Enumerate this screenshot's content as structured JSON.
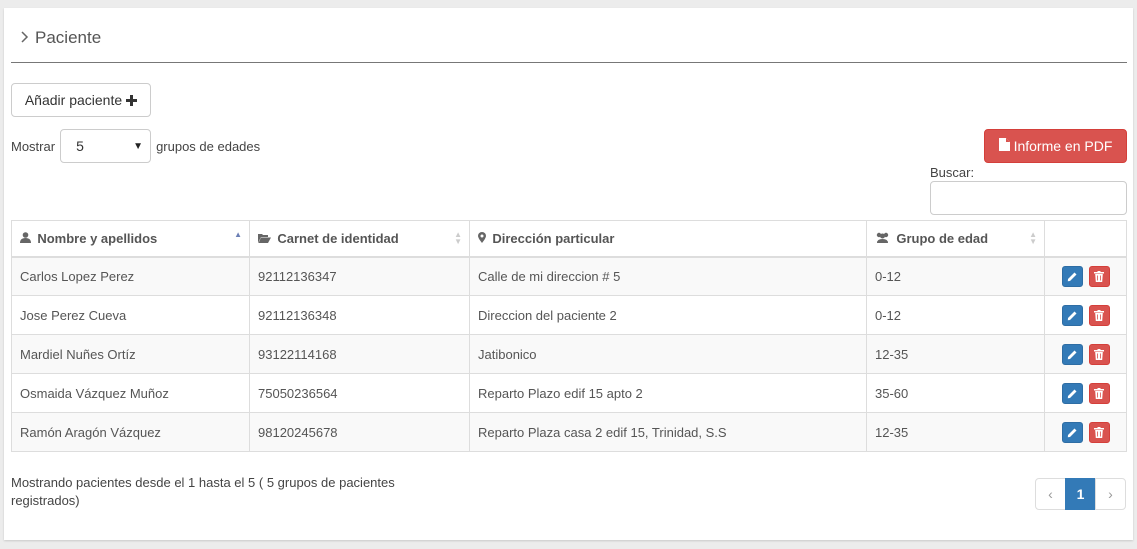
{
  "header": {
    "title": "Paciente",
    "chevron_icon": "chevron-right-icon"
  },
  "toolbar": {
    "add_label": "Añadir paciente",
    "add_icon": "plus-icon"
  },
  "length": {
    "prefix": "Mostrar",
    "selected": "5",
    "suffix": "grupos de edades"
  },
  "pdf": {
    "label": "Informe en PDF",
    "icon": "file-icon",
    "color": "#d9534f"
  },
  "search": {
    "label": "Buscar:",
    "value": "",
    "placeholder": ""
  },
  "table": {
    "headers": [
      {
        "label": "Nombre y apellidos",
        "icon": "user-icon"
      },
      {
        "label": "Carnet de identidad",
        "icon": "folder-open-icon"
      },
      {
        "label": "Dirección particular",
        "icon": "map-marker-icon"
      },
      {
        "label": "Grupo de edad",
        "icon": "users-icon"
      },
      {
        "label": ""
      }
    ],
    "rows": [
      [
        "Carlos Lopez Perez",
        "92112136347",
        "Calle de mi direccion # 5",
        "0-12"
      ],
      [
        "Jose Perez Cueva",
        "92112136348",
        "Direccion del paciente 2",
        "0-12"
      ],
      [
        "Mardiel Nuñes Ortíz",
        "93122114168",
        "Jatibonico",
        "12-35"
      ],
      [
        "Osmaida Vázquez Muñoz",
        "75050236564",
        "Reparto Plazo edif 15 apto 2",
        "35-60"
      ],
      [
        "Ramón Aragón Vázquez",
        "98120245678",
        "Reparto Plaza casa 2 edif 15, Trinidad, S.S",
        "12-35"
      ]
    ]
  },
  "footer": {
    "info": "Mostrando pacientes desde el 1 hasta el 5 ( 5 grupos de pacientes registrados)",
    "pager": {
      "prev": "‹",
      "current": "1",
      "next": "›"
    }
  },
  "colors": {
    "primary": "#337ab7",
    "danger": "#d9534f"
  }
}
